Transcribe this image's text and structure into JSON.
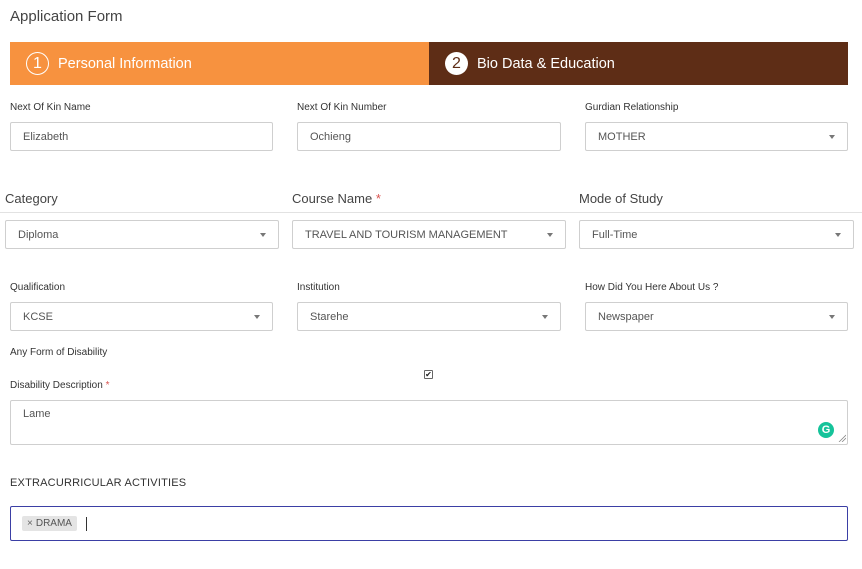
{
  "form": {
    "title": "Application Form"
  },
  "steps": [
    {
      "number": "1",
      "label": "Personal Information"
    },
    {
      "number": "2",
      "label": "Bio Data & Education"
    }
  ],
  "next_of_kin": {
    "name_label": "Next Of Kin Name",
    "name_value": "Elizabeth",
    "number_label": "Next Of Kin Number",
    "number_value": "Ochieng",
    "relationship_label": "Gurdian Relationship",
    "relationship_value": "MOTHER"
  },
  "course": {
    "category_label": "Category",
    "category_value": "Diploma",
    "course_label": "Course Name",
    "course_required": "*",
    "course_value": "TRAVEL AND TOURISM MANAGEMENT",
    "mode_label": "Mode of Study",
    "mode_value": "Full-Time"
  },
  "education": {
    "qualification_label": "Qualification",
    "qualification_value": "KCSE",
    "institution_label": "Institution",
    "institution_value": "Starehe",
    "referral_label": "How Did You Here About Us ?",
    "referral_value": "Newspaper"
  },
  "disability": {
    "any_label": "Any Form of Disability",
    "checked": true,
    "checkmark": "✔",
    "description_label": "Disability Description",
    "description_required": "*",
    "description_value": "Lame",
    "grammarly_glyph": "G"
  },
  "extracurricular": {
    "section_label": "EXTRACURRICULAR ACTIVITIES",
    "tags": [
      {
        "remove": "×",
        "label": "DRAMA"
      }
    ]
  },
  "colors": {
    "step_active": "#f7923f",
    "step_inactive": "#5e2d16",
    "focus_border": "#3b3fa5",
    "grammarly": "#15c39a"
  }
}
